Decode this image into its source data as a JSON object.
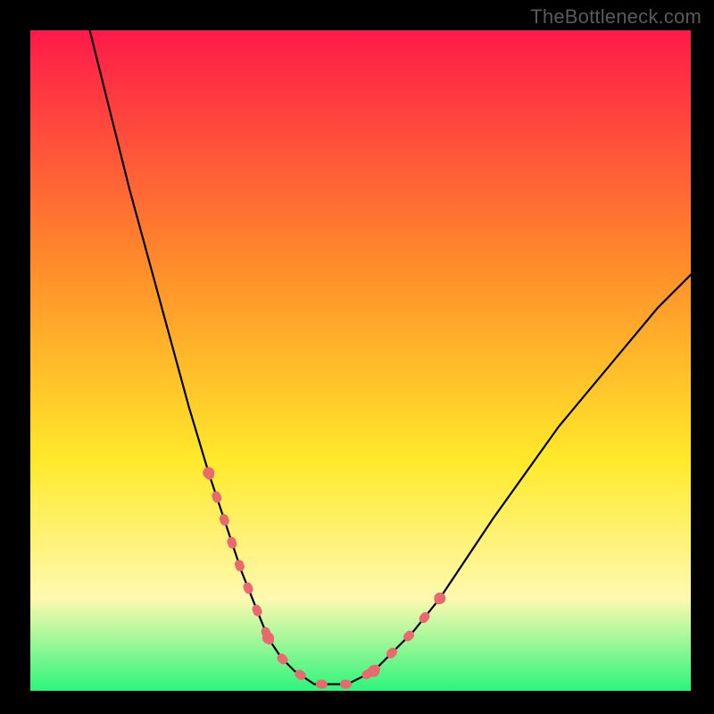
{
  "watermark": "TheBottleneck.com",
  "colors": {
    "gradient_top": "#ff1a4a",
    "gradient_upper_mid": "#ff8a2a",
    "gradient_mid": "#ffe92a",
    "gradient_lower_mid": "#fff9b0",
    "gradient_bottom": "#2cf57b",
    "curve": "#000000",
    "overlay_dots": "#e86a6f",
    "background": "#000000"
  },
  "chart_data": {
    "type": "line",
    "title": "",
    "xlabel": "",
    "ylabel": "",
    "xlim": [
      0,
      100
    ],
    "ylim": [
      0,
      100
    ],
    "grid": false,
    "legend": false,
    "description": "V-shaped bottleneck curve descending steeply from upper-left, reaching a flat minimum, then rising to the right edge. Lower portions of both limbs are overlaid with salmon dotted/dashed segments.",
    "series": [
      {
        "name": "bottleneck-curve",
        "x": [
          9,
          12,
          15,
          18,
          21,
          24,
          27,
          30,
          32,
          34,
          36,
          38,
          40,
          43,
          48,
          52,
          55,
          58,
          62,
          66,
          70,
          75,
          80,
          85,
          90,
          95,
          100
        ],
        "y": [
          100,
          88,
          76,
          65,
          54,
          43,
          33,
          24,
          18,
          13,
          8,
          5,
          3,
          1,
          1,
          3,
          6,
          9,
          14,
          20,
          26,
          33,
          40,
          46,
          52,
          58,
          63
        ]
      }
    ],
    "overlay_segments": [
      {
        "name": "left-dots",
        "x_range": [
          26,
          36
        ],
        "y_range": [
          36,
          8
        ],
        "style": "dotted-dashed"
      },
      {
        "name": "valley-dots",
        "x_range": [
          36,
          52
        ],
        "y_range": [
          8,
          3
        ],
        "style": "dotted-dashed"
      },
      {
        "name": "right-dots",
        "x_range": [
          52,
          64
        ],
        "y_range": [
          3,
          17
        ],
        "style": "dotted-dashed"
      }
    ]
  }
}
